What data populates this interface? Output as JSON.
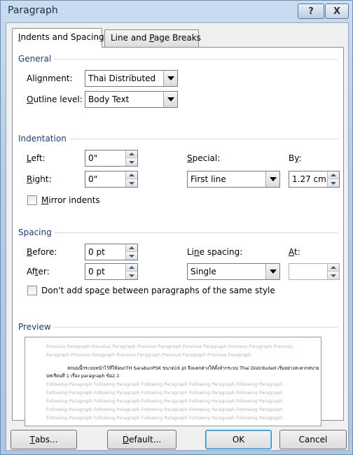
{
  "window": {
    "title": "Paragraph",
    "help_glyph": "?",
    "close_glyph": "X"
  },
  "tabs": [
    {
      "pre": "",
      "u": "I",
      "post": "ndents and Spacing",
      "active": true
    },
    {
      "pre": "Line and ",
      "u": "P",
      "post": "age Breaks",
      "active": false
    }
  ],
  "general": {
    "title": "General",
    "alignment_label": {
      "pre": "Ali",
      "u": "g",
      "post": "nment:"
    },
    "alignment_value": "Thai Distributed",
    "outline_label": {
      "pre": "",
      "u": "O",
      "post": "utline level:"
    },
    "outline_value": "Body Text"
  },
  "indentation": {
    "title": "Indentation",
    "left_label": {
      "pre": "",
      "u": "L",
      "post": "eft:"
    },
    "left_value": "0\"",
    "right_label": {
      "pre": "",
      "u": "R",
      "post": "ight:"
    },
    "right_value": "0\"",
    "special_label": {
      "pre": "",
      "u": "S",
      "post": "pecial:"
    },
    "special_value": "First line",
    "by_label": {
      "pre": "B",
      "u": "y",
      "post": ":"
    },
    "by_value": "1.27 cm",
    "mirror_label": {
      "pre": "",
      "u": "M",
      "post": "irror indents"
    }
  },
  "spacing": {
    "title": "Spacing",
    "before_label": {
      "pre": "",
      "u": "B",
      "post": "efore:"
    },
    "before_value": "0 pt",
    "after_label": {
      "pre": "Af",
      "u": "t",
      "post": "er:"
    },
    "after_value": "0 pt",
    "line_label": {
      "pre": "Li",
      "u": "n",
      "post": "e spacing:"
    },
    "line_value": "Single",
    "at_label": {
      "pre": "",
      "u": "A",
      "post": "t:"
    },
    "at_value": "",
    "dont_add_label": {
      "pre": "Don't add spa",
      "u": "c",
      "post": "e between paragraphs of the same style"
    }
  },
  "preview": {
    "title": "Preview",
    "prev_1": "Previous Paragraph Previous Paragraph Previous Paragraph Previous Paragraph Previous Paragraph Previous",
    "prev_2": "Paragraph Previous Paragraph Previous Paragraph Previous Paragraph Previous Paragraph",
    "cur_1": "สถนนนี้กระบบหน้าไว้ที่ให้อนกTH SarabunPSK ขนาด16 pt จึงแตกต่างให้ตั้งลำกระบบ Thai Distributed เริ่มอย่างสะดวกสบาย",
    "cur_2": "บทเรียนที่ 1 เรื่อง paragraph ข้อ2.1",
    "follow": "Following Paragraph Following Paragraph Following Paragraph Following Paragraph Following Paragraph"
  },
  "buttons": {
    "tabs": {
      "pre": "",
      "u": "T",
      "post": "abs..."
    },
    "default": {
      "pre": "",
      "u": "D",
      "post": "efault..."
    },
    "ok": "OK",
    "cancel": "Cancel"
  }
}
